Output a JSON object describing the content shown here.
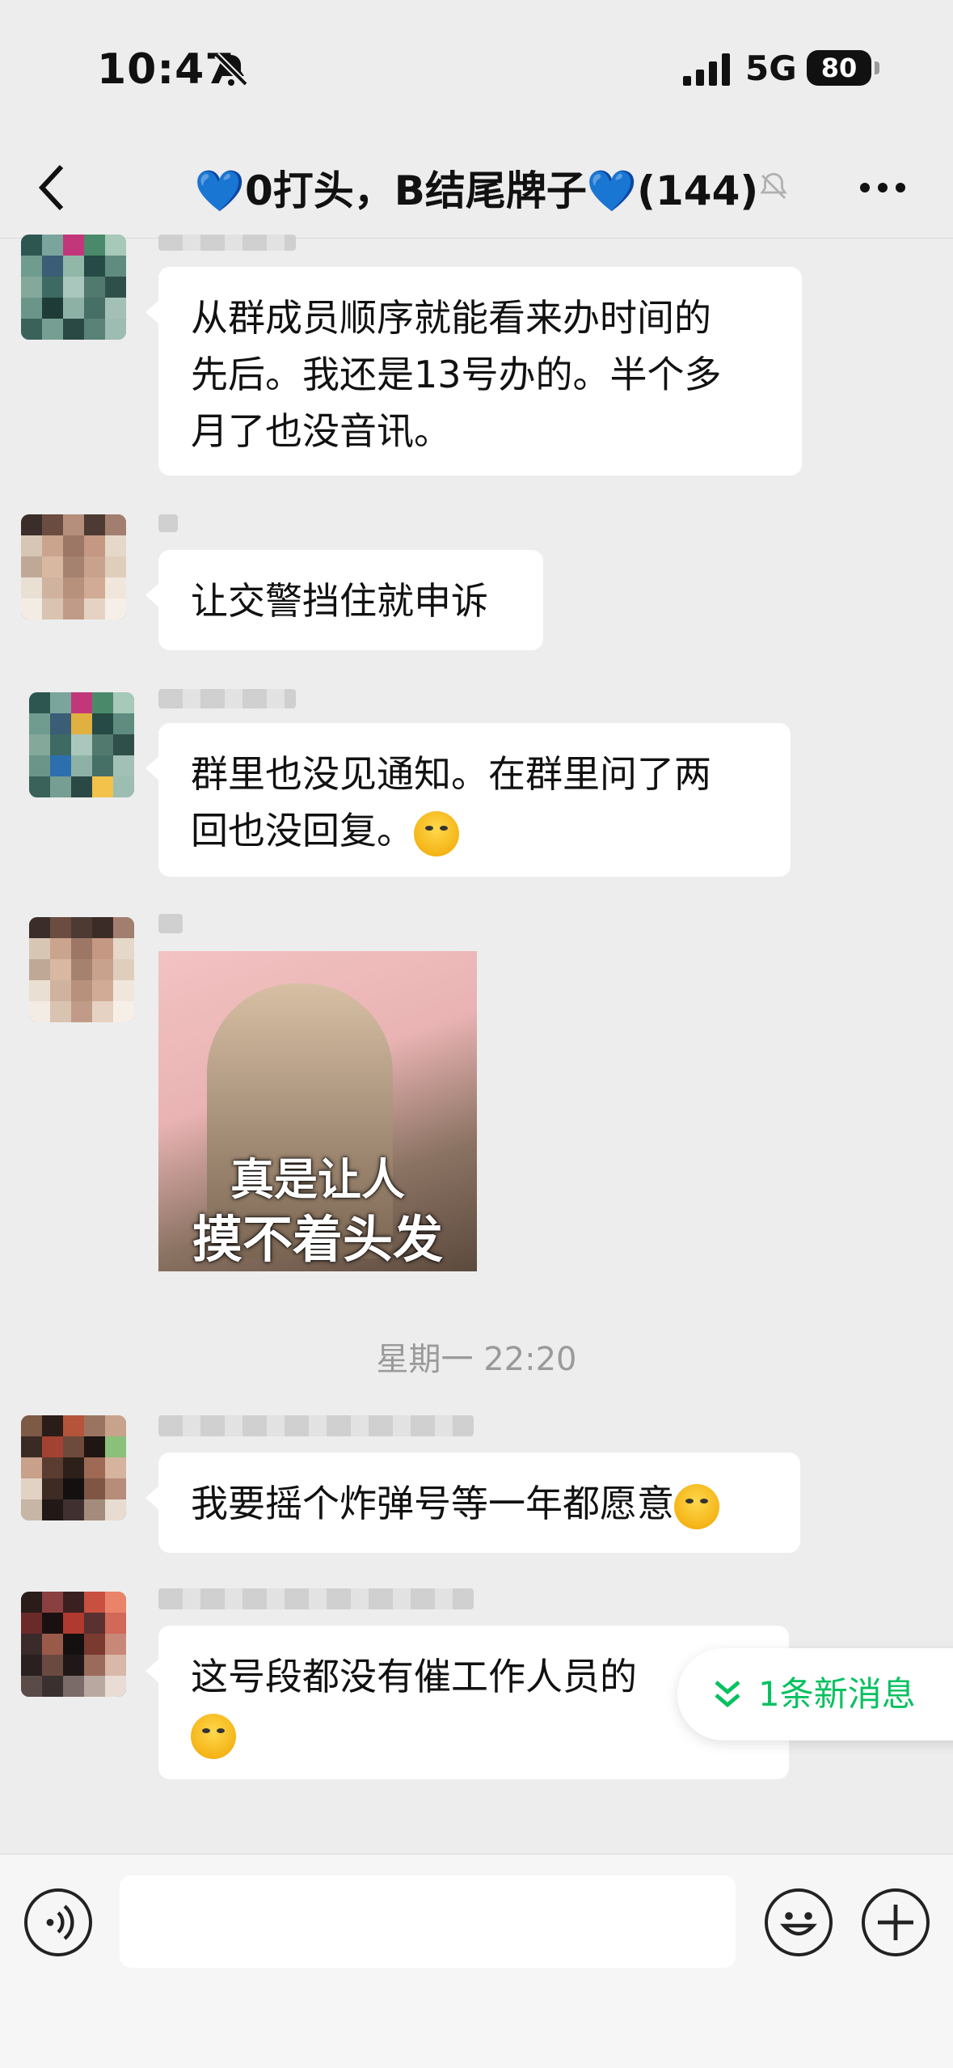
{
  "status_bar": {
    "time": "10:47",
    "network": "5G",
    "battery": "80"
  },
  "nav": {
    "title": "💙0打头，B结尾牌子💙(144)"
  },
  "messages": [
    {
      "lines": [
        "从群成员顺序就能看来办时间的",
        "先后。我还是13号办的。半个多",
        "月了也没音讯。"
      ]
    },
    {
      "lines": [
        "让交警挡住就申诉"
      ]
    },
    {
      "lines": [
        "群里也没见通知。在群里问了两",
        "回也没回复。"
      ]
    },
    {
      "sticker_lines": [
        "真是让人",
        "摸不着头发"
      ]
    },
    {
      "lines": [
        "我要摇个炸弹号等一年都愿意"
      ]
    },
    {
      "lines": [
        "这号段都没有催工作人员的"
      ]
    }
  ],
  "timestamp": "星期一 22:20",
  "new_messages": "1条新消息",
  "colors": {
    "accent": "#07c160",
    "bubble": "#ffffff",
    "background": "#ededed"
  }
}
